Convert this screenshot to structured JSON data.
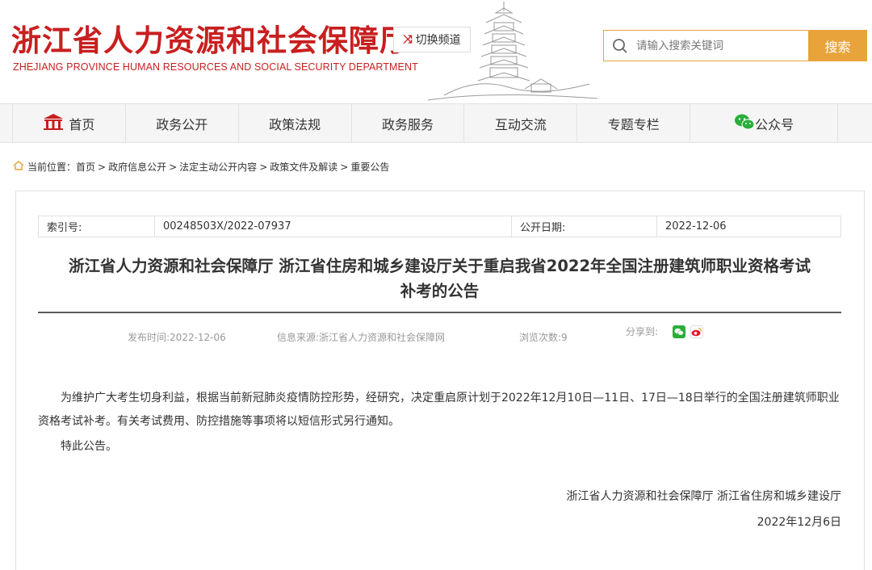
{
  "header": {
    "title_cn": "浙江省人力资源和社会保障厅",
    "title_en": "ZHEJIANG PROVINCE HUMAN RESOURCES AND SOCIAL SECURITY DEPARTMENT",
    "switch_channel": "切换频道",
    "search_placeholder": "请输入搜索关键词",
    "search_button": "搜索",
    "brand_color": "#c81f1f",
    "accent_color": "#e8a43b"
  },
  "nav": {
    "items": [
      {
        "label": "首页",
        "icon": "home-icon"
      },
      {
        "label": "政务公开"
      },
      {
        "label": "政策法规"
      },
      {
        "label": "政务服务"
      },
      {
        "label": "互动交流"
      },
      {
        "label": "专题专栏"
      },
      {
        "label": "公众号",
        "icon": "wechat-icon"
      }
    ]
  },
  "breadcrumb": {
    "prefix": "当前位置：",
    "crumbs": [
      "首页",
      "政府信息公开",
      "法定主动公开内容",
      "政策文件及解读",
      "重要公告"
    ],
    "separator": ">"
  },
  "article": {
    "meta": {
      "index_label": "索引号:",
      "index_value": "00248503X/2022-07937",
      "date_label": "公开日期:",
      "date_value": "2022-12-06"
    },
    "title_line1": "浙江省人力资源和社会保障厅 浙江省住房和城乡建设厅关于重启我省2022年全国注册建筑师职业资格考试",
    "title_line2": "补考的公告",
    "publish_time": "发布时间:2022-12-06",
    "source": "信息来源:浙江省人力资源和社会保障网",
    "views": "浏览次数:9",
    "share_label": "分享到:",
    "paragraphs": [
      "为维护广大考生切身利益，根据当前新冠肺炎疫情防控形势，经研究，决定重启原计划于2022年12月10日—11日、17日—18日举行的全国注册建筑师职业资格考试补考。有关考试费用、防控措施等事项将以短信形式另行通知。",
      "特此公告。"
    ],
    "signature": "浙江省人力资源和社会保障厅  浙江省住房和城乡建设厅",
    "sign_date": "2022年12月6日"
  }
}
